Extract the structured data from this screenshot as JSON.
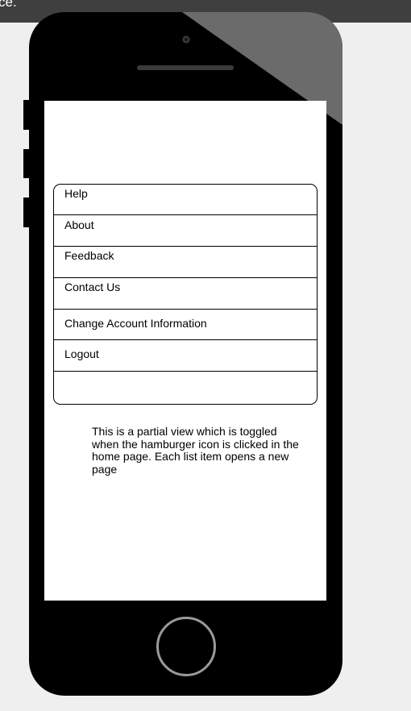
{
  "top_bar": {
    "text": "ce."
  },
  "menu": {
    "items": [
      {
        "label": "Help"
      },
      {
        "label": "About"
      },
      {
        "label": "Feedback"
      },
      {
        "label": "Contact Us"
      },
      {
        "label": "Change Account Information"
      },
      {
        "label": "Logout"
      }
    ]
  },
  "note": {
    "text": "This is a partial view  which is toggled when the hamburger icon is clicked in the home page. Each list item opens a new page"
  },
  "colors": {
    "page_background": "#efefef",
    "phone_body": "#000000",
    "screen": "#ffffff",
    "home_button_ring": "#9a9a9a"
  }
}
